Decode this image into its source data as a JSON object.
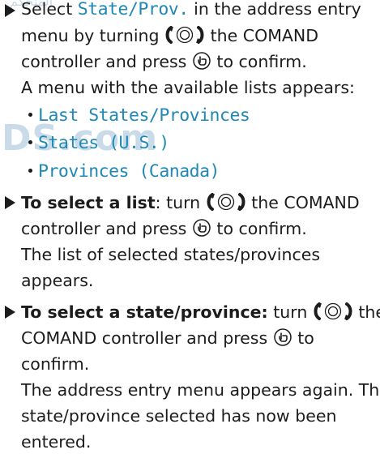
{
  "watermark": {
    "text": "DS.com",
    "top_text": "المتحكم"
  },
  "step1": {
    "pre": "Select ",
    "term": "State/Prov.",
    "post": " in the address entry",
    "line2": "menu by turning",
    "line2b": "the COMAND",
    "line3a": "controller and press",
    "line3b": "to confirm.",
    "line4": "A menu with the available lists appears:"
  },
  "lists": [
    "Last States/Provinces",
    "States (U.S.)",
    "Provinces (Canada)"
  ],
  "step2": {
    "bold": "To select a list",
    "rest": ": turn",
    "rest2": "the COMAND",
    "line2a": "controller and press",
    "line2b": "to confirm.",
    "line3": "The list of selected states/provinces",
    "line4": "appears."
  },
  "step3": {
    "bold": "To select a state/province:",
    "rest": " turn",
    "rest2": "the",
    "line2a": "COMAND controller and press",
    "line2b": "to",
    "line3": "confirm.",
    "line4": "The address entry menu appears again. The",
    "line5": "state/province selected has now been",
    "line6": "entered."
  },
  "icons": {
    "turn": "rotary-turn-icon",
    "press": "press-controller-icon",
    "arrow": "step-arrow-icon"
  },
  "colors": {
    "accent": "#1f88b5",
    "text": "#1c1c1c",
    "watermark": "#c9dbe8"
  }
}
